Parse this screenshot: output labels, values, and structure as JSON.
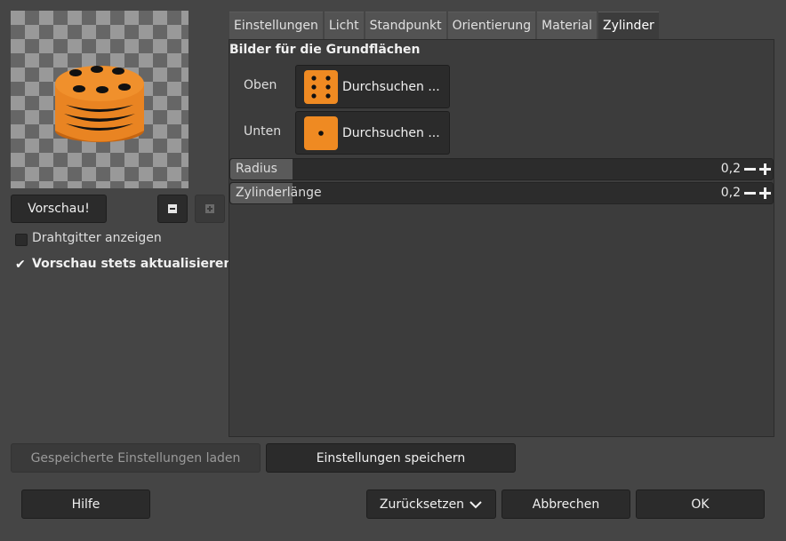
{
  "preview": {
    "button": "Vorschau!",
    "wireframe_label": "Drahtgitter anzeigen",
    "wireframe_checked": false,
    "always_update_label": "Vorschau stets aktualisieren",
    "always_update_checked": true
  },
  "tabs": [
    "Einstellungen",
    "Licht",
    "Standpunkt",
    "Orientierung",
    "Material",
    "Zylinder"
  ],
  "active_tab": "Zylinder",
  "cylinder": {
    "section_title": "Bilder für die Grundflächen",
    "top_label": "Oben",
    "top_button": "Durchsuchen ...",
    "bottom_label": "Unten",
    "bottom_button": "Durchsuchen ...",
    "radius_label": "Radius",
    "radius_value": "0,2",
    "length_label": "Zylinderlänge",
    "length_value": "0,2"
  },
  "footer": {
    "load_settings": "Gespeicherte Einstellungen laden",
    "save_settings": "Einstellungen speichern",
    "help": "Hilfe",
    "reset": "Zurücksetzen",
    "cancel": "Abbrechen",
    "ok": "OK"
  },
  "colors": {
    "accent_orange": "#ef8a22",
    "background": "#454545"
  }
}
